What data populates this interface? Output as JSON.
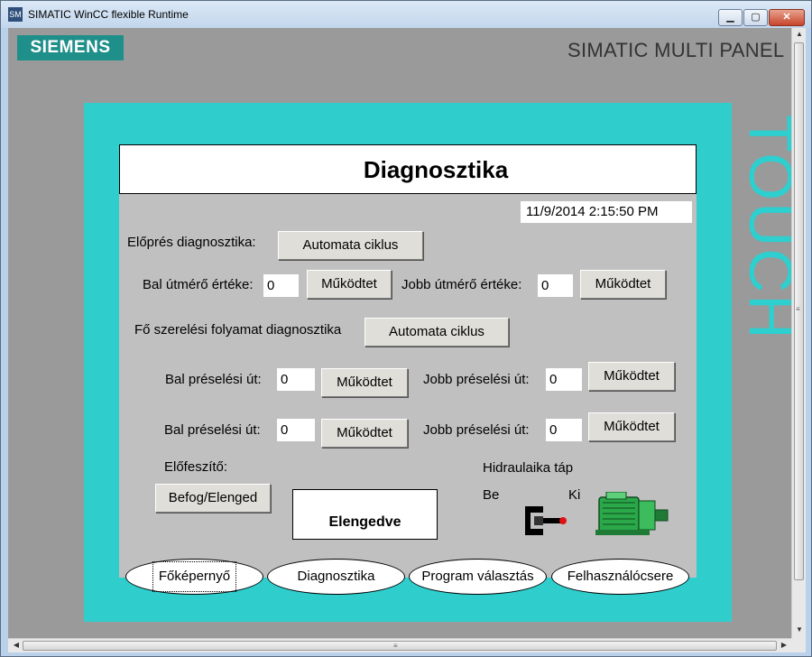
{
  "window": {
    "icon_text": "SM",
    "title": "SIMATIC WinCC flexible Runtime",
    "minimize": "▁",
    "maximize": "▢",
    "close": "✕"
  },
  "panel": {
    "brand": "SIEMENS",
    "model": "SIMATIC MULTI PANEL",
    "touch": "TOUCH"
  },
  "screen": {
    "title": "Diagnosztika",
    "datetime": "11/9/2014 2:15:50 PM",
    "prepress": {
      "label": "Előprés diagnosztika:",
      "button": "Automata ciklus"
    },
    "gauges": {
      "left_label": "Bal útmérő értéke:",
      "left_value": "0",
      "left_button": "Működtet",
      "right_label": "Jobb útmérő értéke:",
      "right_value": "0",
      "right_button": "Működtet"
    },
    "main_assembly": {
      "label": "Fő szerelési folyamat diagnosztika",
      "button": "Automata ciklus"
    },
    "press_rows": [
      {
        "left_label": "Bal préselési út:",
        "left_value": "0",
        "left_button": "Működtet",
        "right_label": "Jobb préselési út:",
        "right_value": "0",
        "right_button": "Működtet"
      },
      {
        "left_label": "Bal préselési út:",
        "left_value": "0",
        "left_button": "Működtet",
        "right_label": "Jobb préselési út:",
        "right_value": "0",
        "right_button": "Működtet"
      }
    ],
    "pretensioner": {
      "label": "Előfeszítő:",
      "button": "Befog/Elenged",
      "status": "Elengedve"
    },
    "hydraulic": {
      "label": "Hidraulaika táp",
      "on": "Be",
      "off": "Ki"
    },
    "nav": [
      "Főképernyő",
      "Diagnosztika",
      "Program választás",
      "Felhasználócsere"
    ]
  },
  "scrollbar": {
    "up": "▲",
    "down": "▼",
    "left": "◀",
    "right": "▶",
    "grip": "≡"
  },
  "colors": {
    "bezel": "#30cdcd",
    "siemens": "#1f8f8a",
    "screen_bg": "#c0c0c0",
    "motor": "#2aa84a"
  }
}
